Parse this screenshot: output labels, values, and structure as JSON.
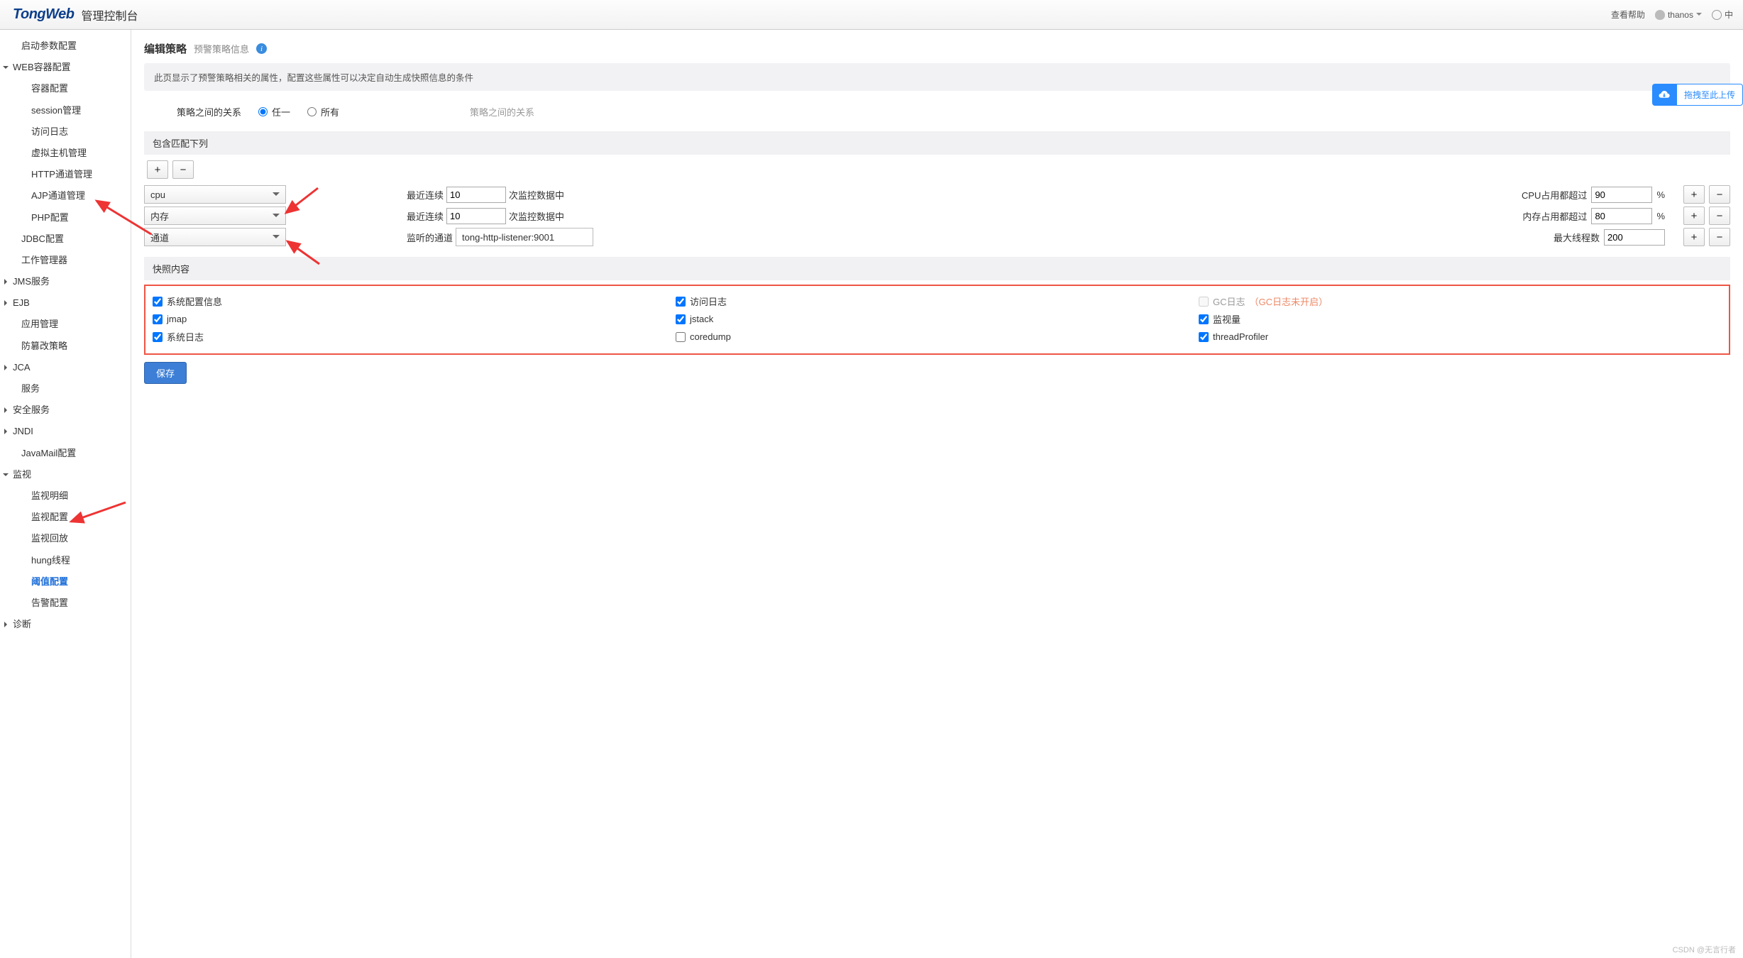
{
  "header": {
    "logo_main": "TongWeb",
    "logo_sub": "管理控制台",
    "help": "查看帮助",
    "user": "thanos",
    "lang": "中"
  },
  "sidebar": {
    "items": [
      {
        "label": "启动参数配置",
        "type": "leaf"
      },
      {
        "label": "WEB容器配置",
        "type": "open",
        "children": [
          {
            "label": "容器配置"
          },
          {
            "label": "session管理"
          },
          {
            "label": "访问日志"
          },
          {
            "label": "虚拟主机管理"
          },
          {
            "label": "HTTP通道管理"
          },
          {
            "label": "AJP通道管理"
          },
          {
            "label": "PHP配置"
          }
        ]
      },
      {
        "label": "JDBC配置",
        "type": "leaf"
      },
      {
        "label": "工作管理器",
        "type": "leaf"
      },
      {
        "label": "JMS服务",
        "type": "closed"
      },
      {
        "label": "EJB",
        "type": "closed"
      },
      {
        "label": "应用管理",
        "type": "leaf"
      },
      {
        "label": "防篡改策略",
        "type": "leaf"
      },
      {
        "label": "JCA",
        "type": "closed"
      },
      {
        "label": "服务",
        "type": "leaf"
      },
      {
        "label": "安全服务",
        "type": "closed"
      },
      {
        "label": "JNDI",
        "type": "closed"
      },
      {
        "label": "JavaMail配置",
        "type": "leaf"
      },
      {
        "label": "监视",
        "type": "open",
        "children": [
          {
            "label": "监视明细"
          },
          {
            "label": "监视配置"
          },
          {
            "label": "监视回放"
          },
          {
            "label": "hung线程"
          },
          {
            "label": "阈值配置",
            "active": true
          },
          {
            "label": "告警配置"
          }
        ]
      },
      {
        "label": "诊断",
        "type": "closed"
      }
    ]
  },
  "page": {
    "title": "编辑策略",
    "subtitle": "预警策略信息",
    "desc": "此页显示了预警策略相关的属性，配置这些属性可以决定自动生成快照信息的条件",
    "relation_label": "策略之间的关系",
    "relation_opts": [
      "任一",
      "所有"
    ],
    "relation_ghost": "策略之间的关系",
    "section_match": "包含匹配下列",
    "rows": [
      {
        "sel": "cpu",
        "mid_l": "最近连续",
        "mid_v": "10",
        "mid_r": "次监控数据中",
        "thr_l": "CPU占用都超过",
        "thr_v": "90",
        "thr_u": "%"
      },
      {
        "sel": "内存",
        "mid_l": "最近连续",
        "mid_v": "10",
        "mid_r": "次监控数据中",
        "thr_l": "内存占用都超过",
        "thr_v": "80",
        "thr_u": "%"
      },
      {
        "sel": "通道",
        "mid_l": "监听的通道",
        "listener": "tong-http-listener:9001",
        "thr_l": "最大线程数",
        "thr_v": "200",
        "thr_u": ""
      }
    ],
    "section_snap": "快照内容",
    "snapshots": [
      [
        {
          "label": "系统配置信息",
          "chk": true
        },
        {
          "label": "访问日志",
          "chk": true
        },
        {
          "label": "GC日志",
          "chk": false,
          "note": "（GC日志未开启）",
          "disabled": true
        }
      ],
      [
        {
          "label": "jmap",
          "chk": true
        },
        {
          "label": "jstack",
          "chk": true
        },
        {
          "label": "监视量",
          "chk": true
        }
      ],
      [
        {
          "label": "系统日志",
          "chk": true
        },
        {
          "label": "coredump",
          "chk": false
        },
        {
          "label": "threadProfiler",
          "chk": true
        }
      ]
    ],
    "save": "保存",
    "upload": "拖拽至此上传"
  },
  "watermark": "CSDN @无言行者"
}
